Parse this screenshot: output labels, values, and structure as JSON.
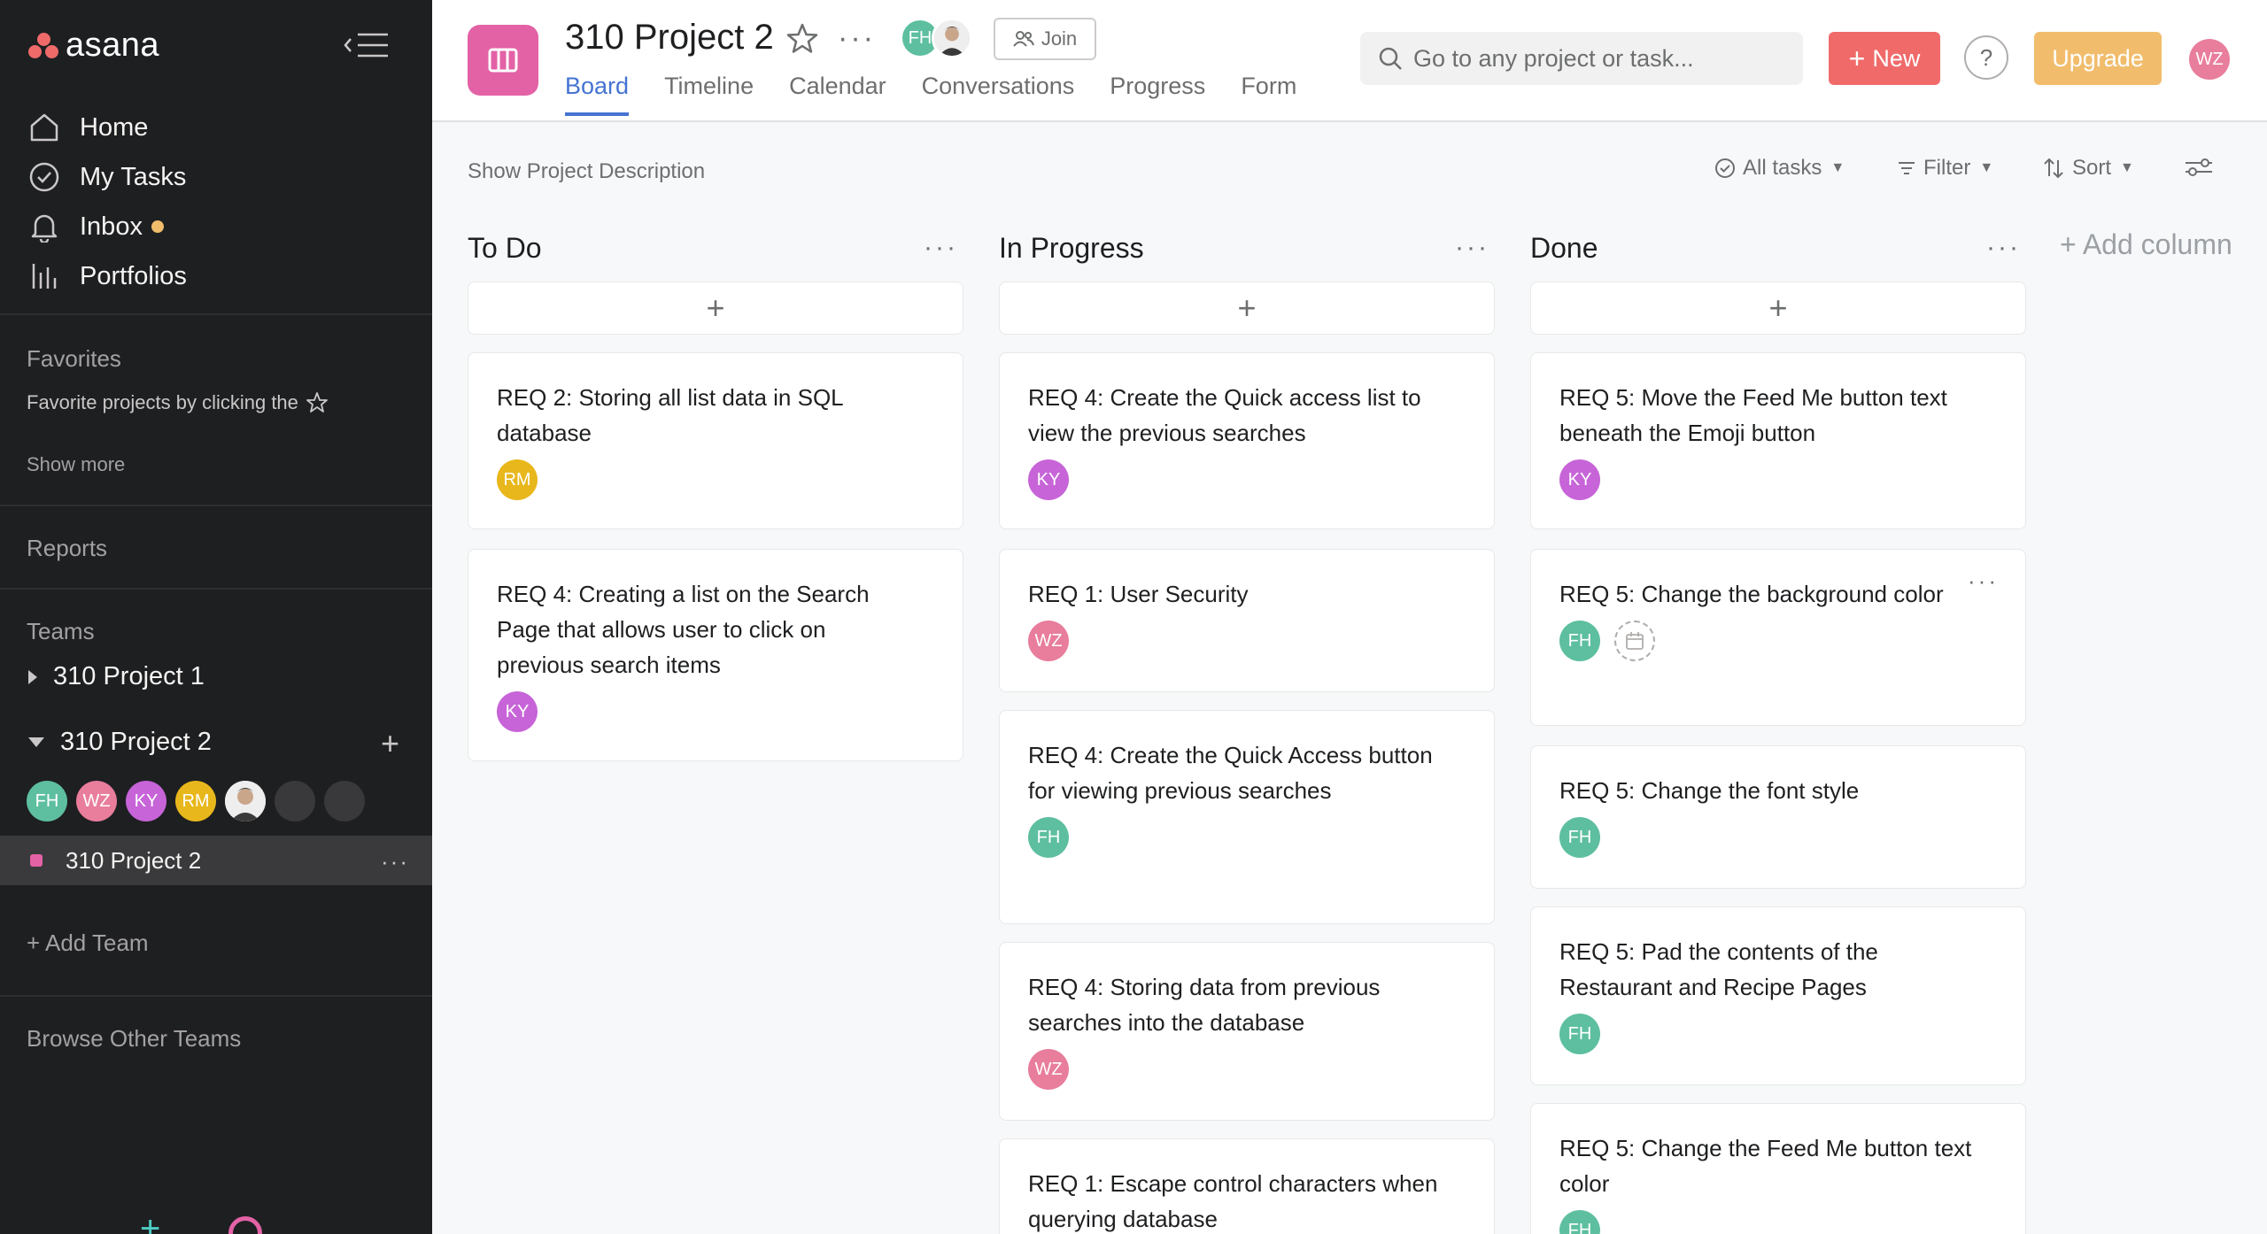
{
  "sidebar": {
    "logo_text": "asana",
    "nav": [
      {
        "label": "Home",
        "icon": "home-icon"
      },
      {
        "label": "My Tasks",
        "icon": "check-circle-icon"
      },
      {
        "label": "Inbox",
        "icon": "bell-icon"
      },
      {
        "label": "Portfolios",
        "icon": "bar-chart-icon"
      }
    ],
    "favorites_label": "Favorites",
    "favorites_hint": "Favorite projects by clicking the",
    "show_more": "Show more",
    "reports_label": "Reports",
    "teams_label": "Teams",
    "teams": [
      {
        "name": "310 Project 1",
        "expanded": false
      },
      {
        "name": "310 Project 2",
        "expanded": true
      }
    ],
    "team_members": [
      {
        "initials": "FH",
        "color": "#5dbf9f"
      },
      {
        "initials": "WZ",
        "color": "#e87d9c"
      },
      {
        "initials": "KY",
        "color": "#c764d8"
      },
      {
        "initials": "RM",
        "color": "#e8b71b"
      }
    ],
    "active_project": "310 Project 2",
    "add_team": "Add Team",
    "browse_teams": "Browse Other Teams"
  },
  "header": {
    "project_title": "310 Project 2",
    "join_label": "Join",
    "tabs": [
      "Board",
      "Timeline",
      "Calendar",
      "Conversations",
      "Progress",
      "Form"
    ],
    "active_tab": "Board",
    "search_placeholder": "Go to any project or task...",
    "new_label": "New",
    "help_label": "?",
    "upgrade_label": "Upgrade",
    "user_initials": "WZ",
    "user_color": "#e87d9c"
  },
  "toolbar": {
    "show_description": "Show Project Description",
    "all_tasks": "All tasks",
    "filter": "Filter",
    "sort": "Sort"
  },
  "board": {
    "add_column": "Add column",
    "columns": [
      {
        "title": "To Do",
        "cards": [
          {
            "title": "REQ 2: Storing all list data in SQL database",
            "assignee": "RM",
            "color": "#e8b71b"
          },
          {
            "title": "REQ 4: Creating a list on the Search Page that allows user to click on previous search items",
            "assignee": "KY",
            "color": "#c764d8"
          }
        ]
      },
      {
        "title": "In Progress",
        "cards": [
          {
            "title": "REQ 4: Create the Quick access list to view the previous searches",
            "assignee": "KY",
            "color": "#c764d8"
          },
          {
            "title": "REQ 1: User Security",
            "assignee": "WZ",
            "color": "#e87d9c"
          },
          {
            "title": "REQ 4: Create the Quick Access button for viewing previous searches",
            "assignee": "FH",
            "color": "#5dbf9f"
          },
          {
            "title": "REQ 4: Storing data from previous searches into the database",
            "assignee": "WZ",
            "color": "#e87d9c"
          },
          {
            "title": "REQ 1: Escape control characters when querying database",
            "assignee": "",
            "color": ""
          }
        ]
      },
      {
        "title": "Done",
        "cards": [
          {
            "title": "REQ 5: Move the Feed Me button text beneath the Emoji button",
            "assignee": "KY",
            "color": "#c764d8"
          },
          {
            "title": "REQ 5: Change the background color",
            "assignee": "FH",
            "color": "#5dbf9f"
          },
          {
            "title": "REQ 5: Change the font style",
            "assignee": "FH",
            "color": "#5dbf9f"
          },
          {
            "title": "REQ 5: Pad the contents of the Restaurant and Recipe Pages",
            "assignee": "FH",
            "color": "#5dbf9f"
          },
          {
            "title": "REQ 5: Change the Feed Me button text color",
            "assignee": "FH",
            "color": "#5dbf9f"
          }
        ]
      }
    ]
  }
}
